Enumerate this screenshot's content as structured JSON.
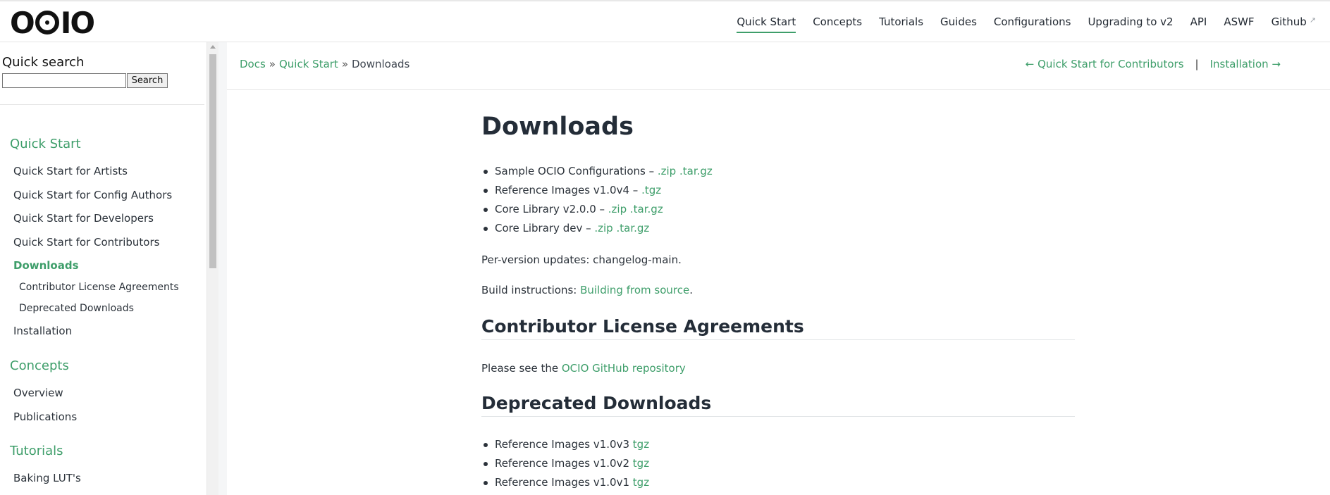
{
  "header": {
    "logo_text": "OCIO",
    "nav": [
      {
        "label": "Quick Start",
        "active": true
      },
      {
        "label": "Concepts"
      },
      {
        "label": "Tutorials"
      },
      {
        "label": "Guides"
      },
      {
        "label": "Configurations"
      },
      {
        "label": "Upgrading to v2"
      },
      {
        "label": "API"
      },
      {
        "label": "ASWF"
      },
      {
        "label": "Github",
        "external": true
      }
    ],
    "external_icon": "external-link-icon"
  },
  "sidebar": {
    "search_title": "Quick search",
    "search_value": "",
    "search_button": "Search",
    "sections": {
      "quick_start": "Quick Start",
      "concepts": "Concepts",
      "tutorials": "Tutorials"
    },
    "quick_start_items": [
      "Quick Start for Artists",
      "Quick Start for Config Authors",
      "Quick Start for Developers",
      "Quick Start for Contributors",
      "Downloads",
      "Installation"
    ],
    "downloads_subitems": [
      "Contributor License Agreements",
      "Deprecated Downloads"
    ],
    "concepts_items": [
      "Overview",
      "Publications"
    ],
    "tutorials_items": [
      "Baking LUT's"
    ]
  },
  "breadcrumb": {
    "docs": "Docs",
    "sep": "»",
    "quick_start": "Quick Start",
    "current": "Downloads"
  },
  "pager": {
    "prev": "← Quick Start for Contributors",
    "separator": "|",
    "next": "Installation →"
  },
  "article": {
    "title": "Downloads",
    "downloads": [
      {
        "text": "Sample OCIO Configurations – ",
        "links": [
          ".zip",
          ".tar.gz"
        ]
      },
      {
        "text": "Reference Images v1.0v4 – ",
        "links": [
          ".tgz"
        ]
      },
      {
        "text": "Core Library v2.0.0 – ",
        "links": [
          ".zip",
          ".tar.gz"
        ]
      },
      {
        "text": "Core Library dev – ",
        "links": [
          ".zip",
          ".tar.gz"
        ]
      }
    ],
    "per_version": "Per-version updates: changelog-main.",
    "build_prefix": "Build instructions: ",
    "build_link": "Building from source",
    "build_suffix": ".",
    "cla_heading": "Contributor License Agreements",
    "cla_prefix": "Please see the ",
    "cla_link": "OCIO GitHub repository",
    "deprecated_heading": "Deprecated Downloads",
    "deprecated": [
      {
        "text": "Reference Images v1.0v3 ",
        "link": "tgz"
      },
      {
        "text": "Reference Images v1.0v2 ",
        "link": "tgz"
      },
      {
        "text": "Reference Images v1.0v1 ",
        "link": "tgz"
      }
    ]
  }
}
